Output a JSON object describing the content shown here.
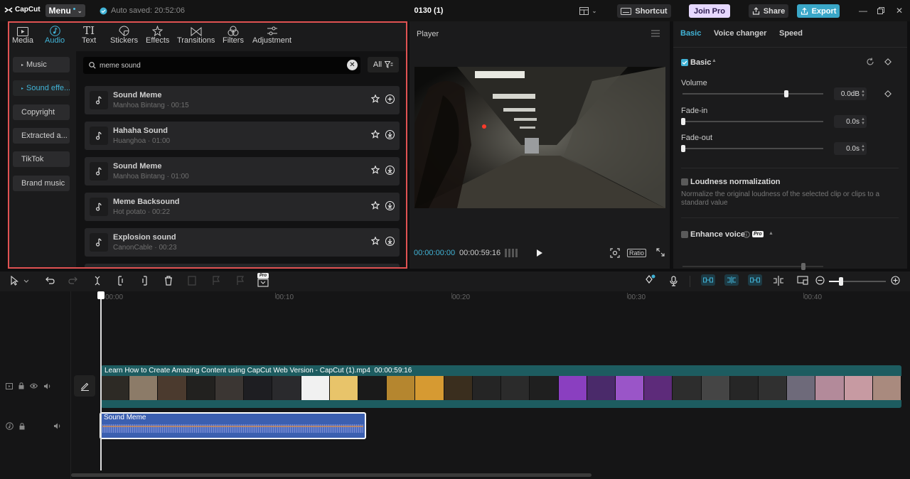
{
  "titlebar": {
    "app_name": "CapCut",
    "menu_label": "Menu",
    "autosave": "Auto saved: 20:52:06",
    "project_title": "0130 (1)",
    "shortcut_label": "Shortcut",
    "join_pro_label": "Join Pro",
    "share_label": "Share",
    "export_label": "Export"
  },
  "left_panel": {
    "tabs": [
      {
        "label": "Media",
        "icon": "media-icon"
      },
      {
        "label": "Audio",
        "icon": "audio-icon"
      },
      {
        "label": "Text",
        "icon": "text-icon"
      },
      {
        "label": "Stickers",
        "icon": "stickers-icon"
      },
      {
        "label": "Effects",
        "icon": "effects-icon"
      },
      {
        "label": "Transitions",
        "icon": "transitions-icon"
      },
      {
        "label": "Filters",
        "icon": "filters-icon"
      },
      {
        "label": "Adjustment",
        "icon": "adjustment-icon"
      }
    ],
    "active_tab": "Audio",
    "categories": [
      "Music",
      "Sound effe...",
      "Copyright",
      "Extracted a...",
      "TikTok",
      "Brand music"
    ],
    "active_category": "Sound effe...",
    "search": {
      "value": "meme sound"
    },
    "filter_label": "All",
    "tracks": [
      {
        "name": "Sound Meme",
        "sub": "Manhoa Bintang · 00:15",
        "action": "add"
      },
      {
        "name": "Hahaha Sound",
        "sub": "Huanghoa · 01:00",
        "action": "download"
      },
      {
        "name": "Sound Meme",
        "sub": "Manhoa Bintang · 01:00",
        "action": "download"
      },
      {
        "name": "Meme Backsound",
        "sub": "Hot potato · 00:22",
        "action": "download"
      },
      {
        "name": "Explosion sound",
        "sub": "CanonCable · 00:23",
        "action": "download"
      }
    ]
  },
  "player": {
    "title": "Player",
    "current_time": "00:00:00:00",
    "total_time": "00:00:59:16",
    "ratio_label": "Ratio"
  },
  "right_panel": {
    "tabs": [
      "Basic",
      "Voice changer",
      "Speed"
    ],
    "active_tab": "Basic",
    "section_basic": "Basic",
    "volume_label": "Volume",
    "volume_value": "0.0dB",
    "fadein_label": "Fade-in",
    "fadein_value": "0.0s",
    "fadeout_label": "Fade-out",
    "fadeout_value": "0.0s",
    "loudness_label": "Loudness normalization",
    "loudness_note": "Normalize the original loudness of the selected clip or clips to a standard value",
    "enhance_label": "Enhance voice",
    "pro_badge": "Pro"
  },
  "timeline": {
    "ruler": [
      "00:00",
      "00:10",
      "00:20",
      "00:30",
      "00:40"
    ],
    "video_clip_title": "Learn How to Create Amazing Content using CapCut Web Version - CapCut (1).mp4",
    "video_clip_duration": "00:00:59:16",
    "audio_clip_label": "Sound Meme",
    "pro_badge": "Pro"
  },
  "colors": {
    "accent": "#41b3d6",
    "highlight_border": "#e05252",
    "export_bg": "#3aa7c8",
    "joinpro_bg": "#e6d8ff",
    "video_clip": "#1d5c60",
    "audio_clip": "#3b5fb0"
  }
}
